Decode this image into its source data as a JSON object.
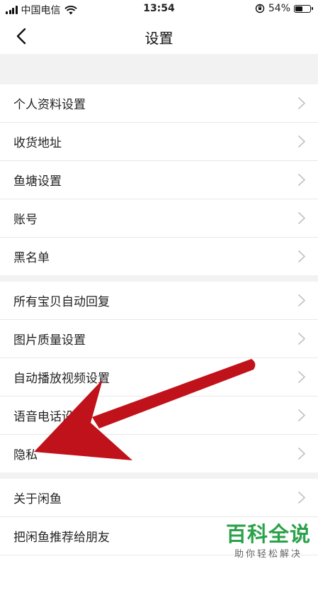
{
  "status_bar": {
    "carrier": "中国电信",
    "time": "13:54",
    "battery_percent": "54%",
    "battery_level": 0.54
  },
  "header": {
    "title": "设置"
  },
  "groups": [
    {
      "items": [
        {
          "label": "个人资料设置"
        },
        {
          "label": "收货地址"
        },
        {
          "label": "鱼塘设置"
        },
        {
          "label": "账号"
        },
        {
          "label": "黑名单"
        }
      ]
    },
    {
      "items": [
        {
          "label": "所有宝贝自动回复"
        },
        {
          "label": "图片质量设置"
        },
        {
          "label": "自动播放视频设置"
        },
        {
          "label": "语音电话设置"
        },
        {
          "label": "隐私"
        }
      ]
    },
    {
      "items": [
        {
          "label": "关于闲鱼"
        },
        {
          "label": "把闲鱼推荐给朋友"
        },
        {
          "label": ""
        }
      ]
    }
  ],
  "watermark": {
    "title": "百科全说",
    "subtitle": "助你轻松解决"
  },
  "colors": {
    "arrow": "#c0121a",
    "watermark": "#2aa24a"
  }
}
